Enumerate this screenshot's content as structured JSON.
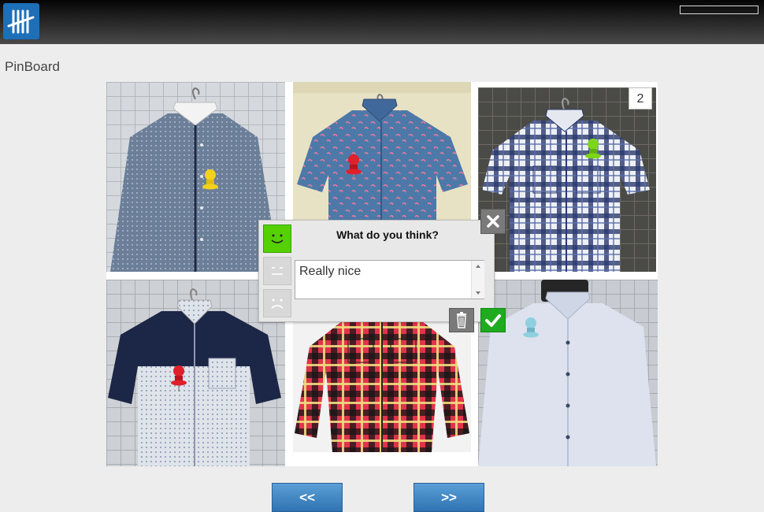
{
  "app": {
    "logo_icon": "tally-marks-logo",
    "brand_color": "#1d6fb7"
  },
  "page": {
    "title": "PinBoard"
  },
  "board": {
    "count_badge": "2",
    "tiles": [
      {
        "name": "tile-grey-dotted-shirt",
        "pin_color": "#f2d21c"
      },
      {
        "name": "tile-blue-flamingo-shirt",
        "pin_color": "#e0202a"
      },
      {
        "name": "tile-plaid-short-sleeve-shirt",
        "pin_color": "#7dd51c"
      },
      {
        "name": "tile-navy-two-tone-shirt",
        "pin_color": "#e0202a"
      },
      {
        "name": "tile-red-flannel-shirt",
        "pin_color": ""
      },
      {
        "name": "tile-light-blue-shirt",
        "pin_color": "#8fd0e0"
      }
    ]
  },
  "dialog": {
    "title": "What do you think?",
    "comment_value": "Really nice",
    "selected_mood": "happy",
    "happy_icon": "smiley-happy-icon",
    "neutral_icon": "smiley-neutral-icon",
    "sad_icon": "smiley-sad-icon",
    "close_icon": "close-icon",
    "delete_icon": "trash-icon",
    "confirm_icon": "checkmark-icon"
  },
  "nav": {
    "prev_label": "<<",
    "next_label": ">>"
  }
}
